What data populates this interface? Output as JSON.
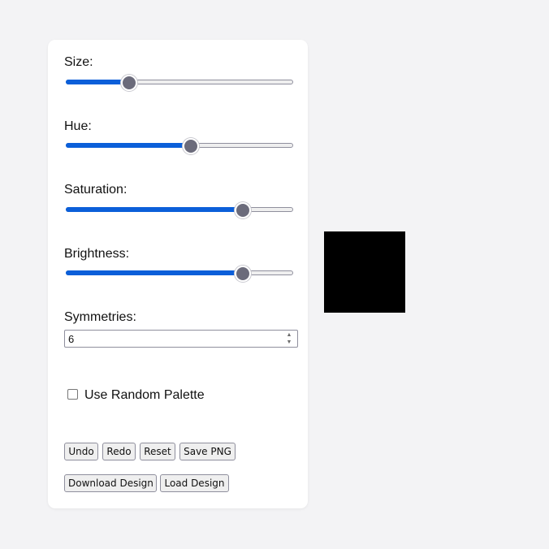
{
  "controls": {
    "size": {
      "label": "Size:",
      "value_fraction": 0.28
    },
    "hue": {
      "label": "Hue:",
      "value_fraction": 0.55
    },
    "saturation": {
      "label": "Saturation:",
      "value_fraction": 0.78
    },
    "brightness": {
      "label": "Brightness:",
      "value_fraction": 0.78
    },
    "symmetries": {
      "label": "Symmetries:",
      "value": "6"
    },
    "random_palette": {
      "label": "Use Random Palette",
      "checked": false
    }
  },
  "buttons": {
    "undo": "Undo",
    "redo": "Redo",
    "reset": "Reset",
    "save_png": "Save PNG",
    "download_design": "Download Design",
    "load_design": "Load Design"
  },
  "preview": {
    "color": "#000000"
  },
  "colors": {
    "accent": "#0b5fd9",
    "thumb": "#6b6b7b",
    "page_background": "#f3f3f5",
    "panel_background": "#ffffff"
  },
  "icons": {
    "spin_up": "chevron-up-icon",
    "spin_down": "chevron-down-icon"
  }
}
